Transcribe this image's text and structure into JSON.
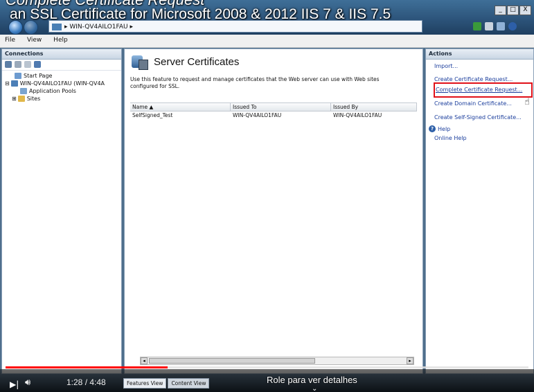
{
  "video": {
    "caption_top": "Complete Certificate Request",
    "caption": "an SSL Certificate for Microsoft 2008 & 2012 IIS 7 & IIS 7.5",
    "time": "1:28 / 4:48",
    "progress": 0.31,
    "buffered": 0.88,
    "overlay_hint": "Role para ver detalhes",
    "play_icon": "play-pause-icon",
    "volume_icon": "volume-icon"
  },
  "window": {
    "address": "▸  WIN-QV4AILO1FAU  ▸",
    "controls": [
      "_",
      "□",
      "X"
    ]
  },
  "menu": [
    "File",
    "View",
    "Help"
  ],
  "connections": {
    "heading": "Connections",
    "tree": [
      {
        "label": "Start Page",
        "indent": 1
      },
      {
        "label": "WIN-QV4AILO1FAU (WIN-QV4A",
        "indent": 0
      },
      {
        "label": "Application Pools",
        "indent": 2
      },
      {
        "label": "Sites",
        "indent": 2
      }
    ]
  },
  "main": {
    "title": "Server Certificates",
    "description": "Use this feature to request and manage certificates that the Web server can use with Web sites configured for SSL.",
    "columns": [
      "Name  ▲",
      "Issued To",
      "Issued By"
    ],
    "rows": [
      [
        "SelfSigned_Test",
        "WIN-QV4AILO1FAU",
        "WIN-QV4AILO1FAU"
      ]
    ],
    "view_tabs": [
      "Features View",
      "Content View"
    ]
  },
  "actions": {
    "heading": "Actions",
    "items": [
      "Import...",
      "Create Certificate Request...",
      "Complete Certificate Request...",
      "Create Domain Certificate...",
      "Create Self-Signed Certificate..."
    ],
    "help": "Help",
    "online_help": "Online Help",
    "highlight_color": "#e01018"
  }
}
